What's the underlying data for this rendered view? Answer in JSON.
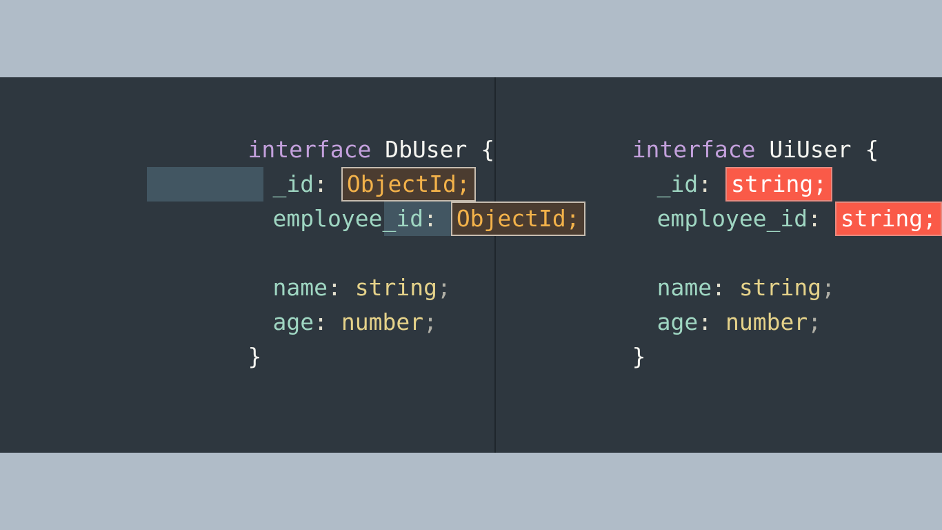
{
  "left": {
    "keyword": "interface",
    "name": "DbUser",
    "open": "{",
    "close": "}",
    "field1_name": "_id",
    "field1_type": "ObjectId;",
    "field2_name": "employee_id",
    "field2_type": "ObjectId;",
    "field3_name": "name",
    "field3_type": "string",
    "field4_name": "age",
    "field4_type": "number",
    "colon": ":",
    "semi": ";"
  },
  "right": {
    "keyword": "interface",
    "name": "UiUser",
    "open": "{",
    "close": "}",
    "field1_name": "_id",
    "field1_type": "string;",
    "field2_name": "employee_id",
    "field2_type": "string;",
    "field3_name": "name",
    "field3_type": "string",
    "field4_name": "age",
    "field4_type": "number",
    "colon": ":",
    "semi": ";"
  }
}
